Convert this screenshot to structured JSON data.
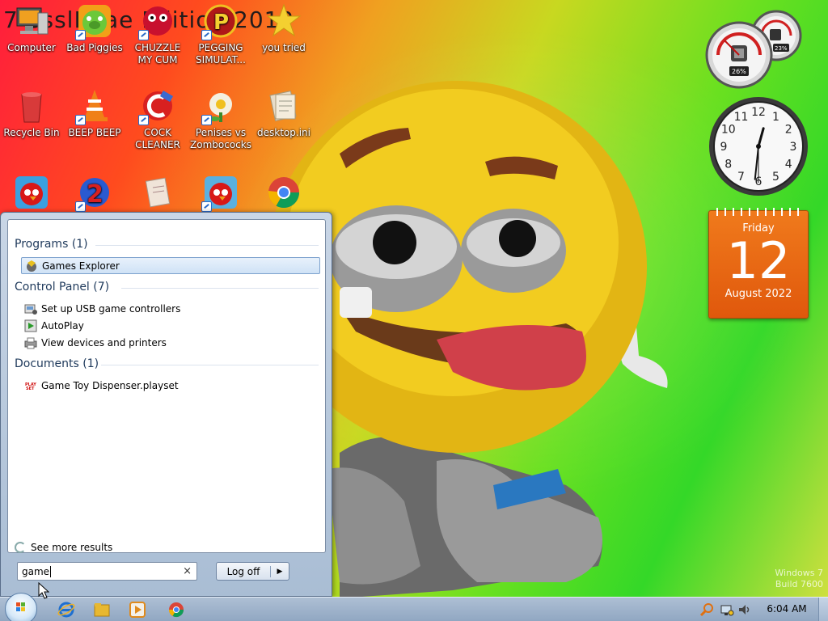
{
  "wallpaper": {
    "title": "7 SsslImae Edition 2012",
    "watermark_line1": "Windows 7",
    "watermark_line2": "Build 7600"
  },
  "desktop_icons": [
    {
      "label": "Computer",
      "icon": "computer-icon"
    },
    {
      "label": "Bad Piggies",
      "icon": "bad-piggies-icon"
    },
    {
      "label": "CHUZZLE MY CUM",
      "icon": "chuzzle-icon"
    },
    {
      "label": "PEGGING SIMULAT...",
      "icon": "pegging-icon"
    },
    {
      "label": "you tried",
      "icon": "star-icon"
    },
    {
      "label": "Recycle Bin",
      "icon": "recycle-bin-icon"
    },
    {
      "label": "BEEP BEEP",
      "icon": "vlc-cone-icon"
    },
    {
      "label": "COCK CLEANER",
      "icon": "ccleaner-icon"
    },
    {
      "label": "Penises vs Zombococks",
      "icon": "plants-vs-zombies-icon"
    },
    {
      "label": "desktop.ini",
      "icon": "ini-file-icon"
    },
    {
      "label": "",
      "icon": "angry-birds-icon"
    },
    {
      "label": "",
      "icon": "number-two-icon"
    },
    {
      "label": "",
      "icon": "document-icon"
    },
    {
      "label": "",
      "icon": "angry-birds-icon"
    },
    {
      "label": "",
      "icon": "chrome-icon"
    }
  ],
  "gadgets": {
    "meter": {
      "cpu": "26%",
      "memory": "23%"
    },
    "clock": {
      "hour": 12,
      "minute": 31,
      "second": 30,
      "numerals": [
        "12",
        "1",
        "2",
        "3",
        "4",
        "5",
        "6",
        "7",
        "8",
        "9",
        "10",
        "11"
      ]
    },
    "calendar": {
      "day": "Friday",
      "date": "12",
      "month": "August 2022"
    }
  },
  "start_menu": {
    "groups": [
      {
        "header": "Programs (1)",
        "items": [
          {
            "label": "Games Explorer",
            "icon": "games-explorer-icon",
            "selected": true
          }
        ]
      },
      {
        "header": "Control Panel (7)",
        "items": [
          {
            "label": "Set up USB game controllers",
            "icon": "game-controller-icon"
          },
          {
            "label": "AutoPlay",
            "icon": "autoplay-icon"
          },
          {
            "label": "View devices and printers",
            "icon": "printer-icon"
          }
        ]
      },
      {
        "header": "Documents (1)",
        "items": [
          {
            "label": "Game Toy Dispenser.playset",
            "icon": "playset-file-icon"
          }
        ]
      }
    ],
    "see_more": "See more results",
    "search_value": "game",
    "clear_glyph": "×",
    "logoff_label": "Log off",
    "logoff_arrow": "▶"
  },
  "taskbar": {
    "pinned": [
      {
        "name": "internet-explorer-icon",
        "color": "#1e6fd0"
      },
      {
        "name": "explorer-folder-icon",
        "color": "#e8b830"
      },
      {
        "name": "media-player-icon",
        "color": "#e08a1c"
      },
      {
        "name": "chrome-icon",
        "color": "#2e9e44"
      }
    ],
    "time": "6:04 AM"
  }
}
